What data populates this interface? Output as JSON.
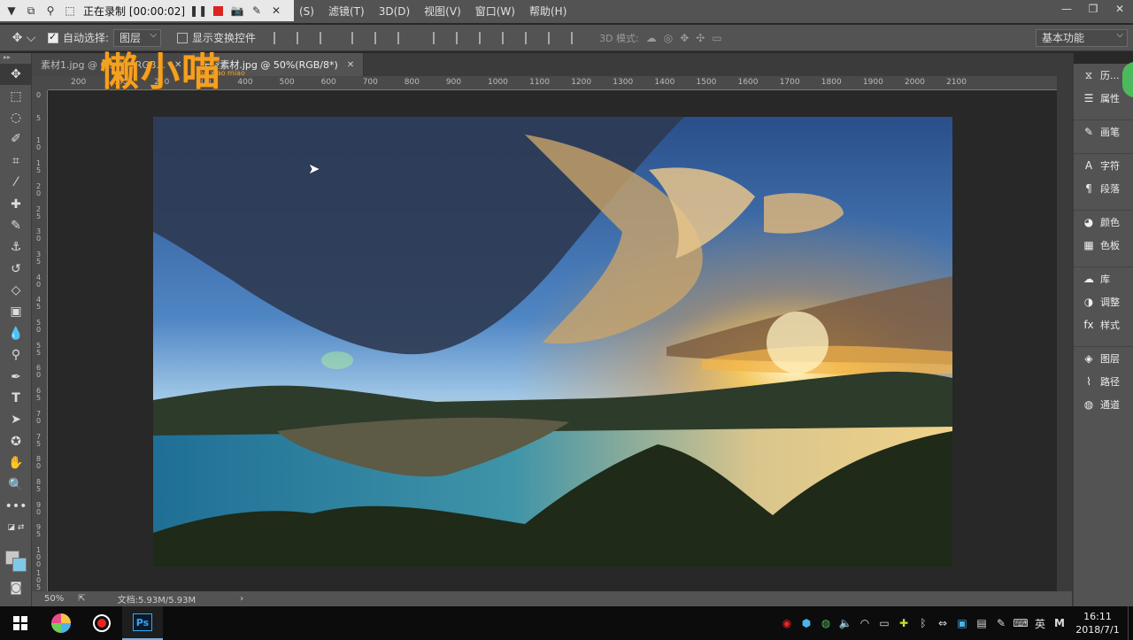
{
  "recorder": {
    "status": "正在录制 [00:00:02]"
  },
  "menu": [
    "(S)",
    "滤镜(T)",
    "3D(D)",
    "视图(V)",
    "窗口(W)",
    "帮助(H)"
  ],
  "options": {
    "auto_select_label": "自动选择:",
    "auto_select_value": "图层",
    "show_transform_label": "显示变换控件",
    "mode_3d_label": "3D 模式:",
    "workspace": "基本功能"
  },
  "tabs": [
    {
      "label": "素材1.jpg @ 66.7%(RGB..."
    },
    {
      "label": "天空素材.jpg @ 50%(RGB/8*)"
    }
  ],
  "ruler_h": [
    "200",
    "150",
    "250",
    "300",
    "400",
    "500",
    "600",
    "700",
    "800",
    "900",
    "1000",
    "1100",
    "1200",
    "1300",
    "1400",
    "1500",
    "1600",
    "1700",
    "1800",
    "1900",
    "2000",
    "2100"
  ],
  "ruler_v": [
    "0",
    "5",
    "1 0",
    "1 5",
    "2 0",
    "2 5",
    "3 0",
    "3 5",
    "4 0",
    "4 5",
    "5 0",
    "5 5",
    "6 0",
    "6 5",
    "7 0",
    "7 5",
    "8 0",
    "8 5",
    "9 0",
    "9 5",
    "1 0 0",
    "1 0 5"
  ],
  "status": {
    "zoom": "50%",
    "doc": "文档:5.93M/5.93M"
  },
  "dock": [
    {
      "icon": "history-icon",
      "label": "历..."
    },
    {
      "icon": "properties-icon",
      "label": "属性"
    },
    {
      "icon": "brush-panel-icon",
      "label": "画笔"
    },
    {
      "icon": "character-icon",
      "label": "字符"
    },
    {
      "icon": "paragraph-icon",
      "label": "段落"
    },
    {
      "icon": "color-icon",
      "label": "颜色"
    },
    {
      "icon": "swatches-icon",
      "label": "色板"
    },
    {
      "icon": "libraries-icon",
      "label": "库"
    },
    {
      "icon": "adjustments-icon",
      "label": "调整"
    },
    {
      "icon": "styles-icon",
      "label": "样式"
    },
    {
      "icon": "layers-icon",
      "label": "图层"
    },
    {
      "icon": "paths-icon",
      "label": "路径"
    },
    {
      "icon": "channels-icon",
      "label": "通道"
    }
  ],
  "watermark": {
    "main": "懒小喵",
    "sub": "lan xiao miao"
  },
  "taskbar": {
    "ps_label": "Ps",
    "ime": "英",
    "time": "16:11",
    "date": "2018/7/1"
  }
}
